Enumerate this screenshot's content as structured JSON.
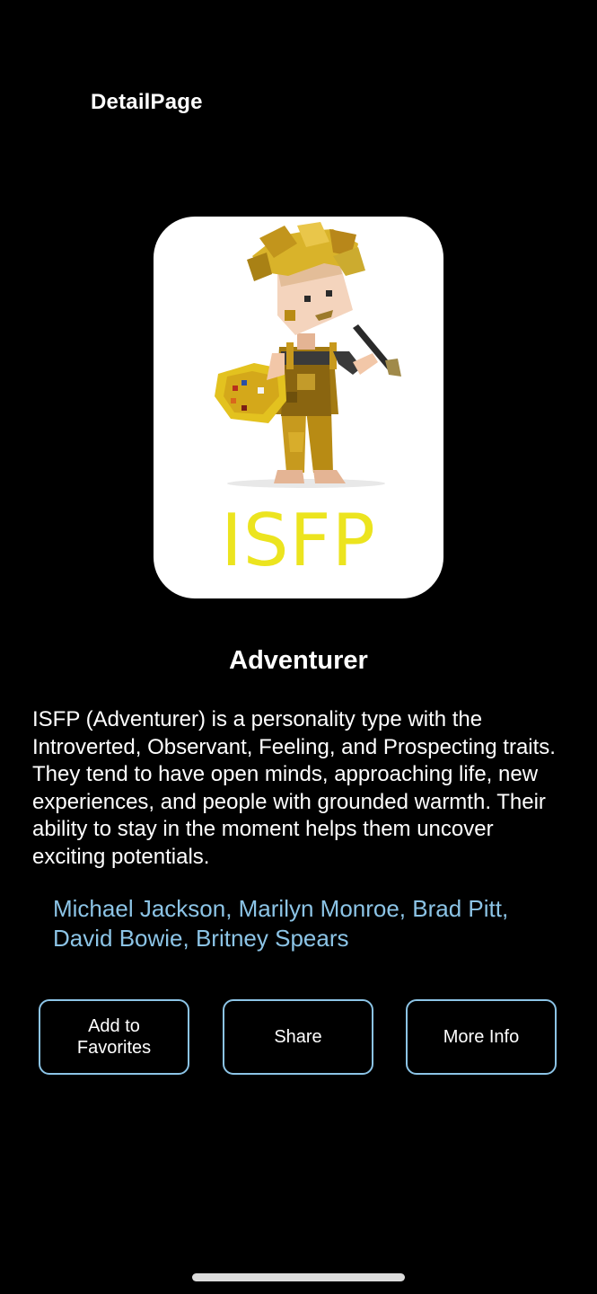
{
  "header": {
    "title": "DetailPage"
  },
  "hero": {
    "type_code": "ISFP",
    "illustration_icon": "adventurer-painter-illustration",
    "type_color": "#ece41f"
  },
  "detail": {
    "type_name": "Adventurer",
    "description": "ISFP (Adventurer) is a personality type with the Introverted, Observant, Feeling, and Prospecting traits. They tend to have open minds, approaching life, new experiences, and people with grounded warmth. Their ability to stay in the moment helps them uncover exciting potentials.",
    "famous_people": "Michael Jackson, Marilyn Monroe, Brad Pitt, David Bowie, Britney Spears"
  },
  "actions": {
    "favorites_label": "Add to Favorites",
    "share_label": "Share",
    "more_info_label": "More Info"
  },
  "colors": {
    "background": "#000000",
    "accent": "#8cc4e6",
    "text": "#ffffff"
  }
}
